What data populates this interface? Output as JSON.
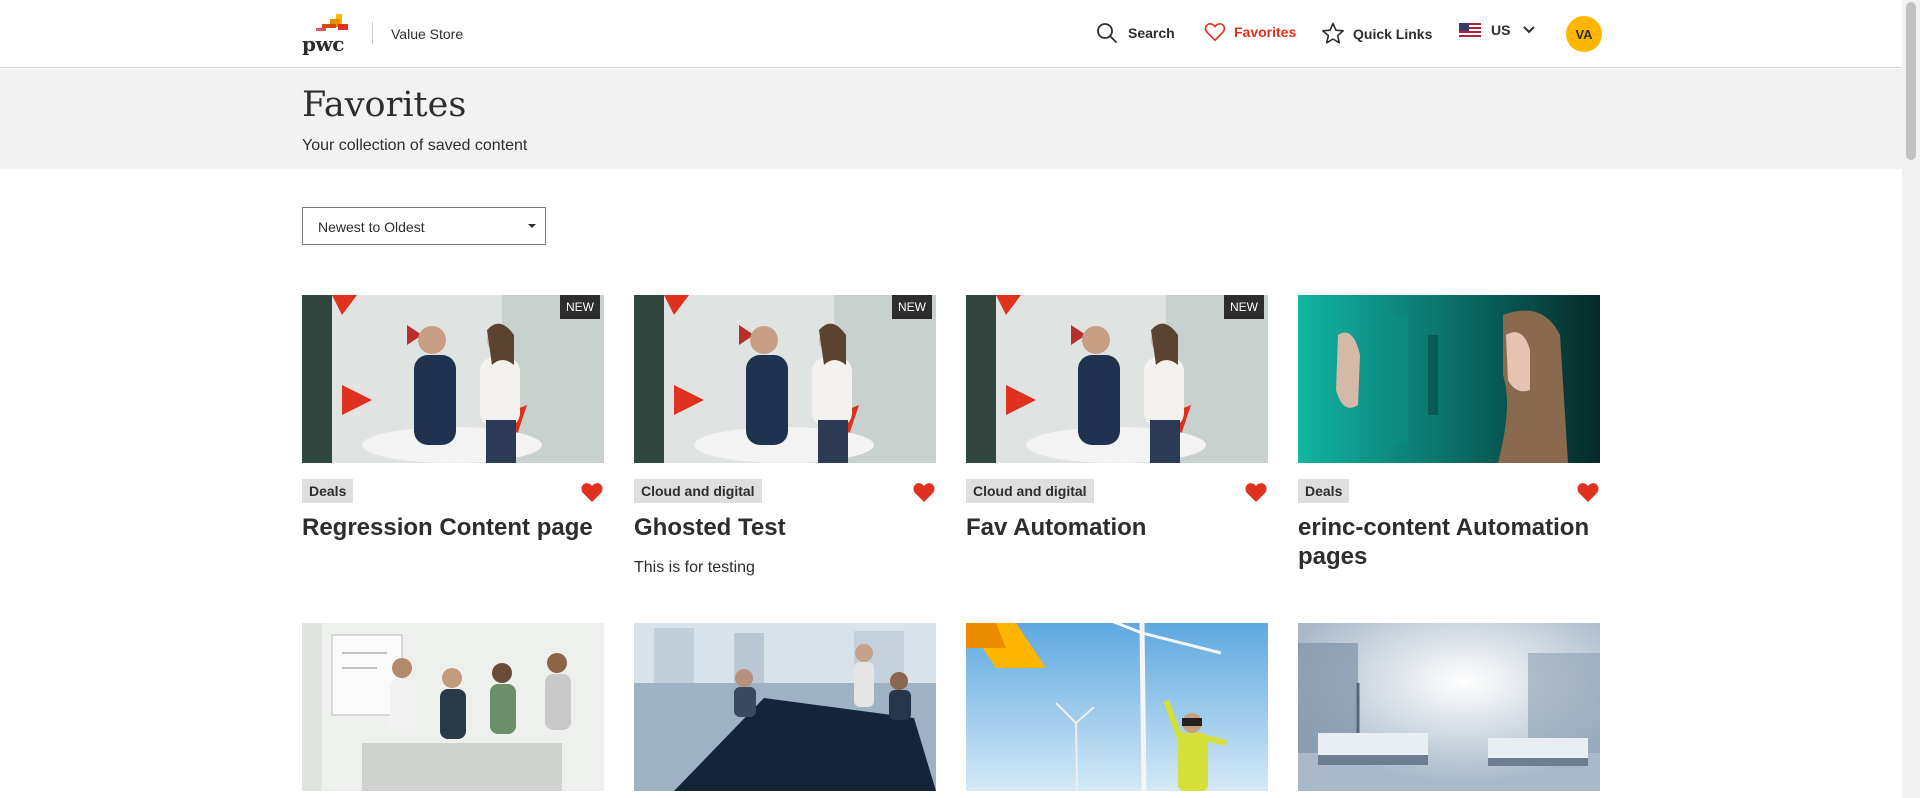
{
  "header": {
    "logo_text": "pwc",
    "store_name": "Value Store",
    "nav": {
      "search": "Search",
      "favorites": "Favorites",
      "quick_links": "Quick Links",
      "locale": "US"
    },
    "avatar_initials": "VA"
  },
  "hero": {
    "title": "Favorites",
    "subtitle": "Your collection of saved content"
  },
  "sort": {
    "selected": "Newest to Oldest"
  },
  "cards": [
    {
      "badge": "NEW",
      "tag": "Deals",
      "title": "Regression Content page",
      "description": "",
      "image": "handshake-office"
    },
    {
      "badge": "NEW",
      "tag": "Cloud and digital",
      "title": "Ghosted Test",
      "description": "This is for testing",
      "image": "handshake-office"
    },
    {
      "badge": "NEW",
      "tag": "Cloud and digital",
      "title": "Fav Automation",
      "description": "",
      "image": "handshake-office"
    },
    {
      "badge": "",
      "tag": "Deals",
      "title": "erinc-content Automation pages",
      "description": "",
      "image": "woman-teal-screen"
    },
    {
      "image": "team-meeting-whiteboard"
    },
    {
      "image": "boardroom-meeting"
    },
    {
      "image": "wind-turbines-vr"
    },
    {
      "image": "hospital-ward"
    }
  ],
  "colors": {
    "accent": "#e0301e",
    "avatar": "#ffb600",
    "hero_bg": "#f2f2f2",
    "badge_bg": "#2d2d2d",
    "tag_bg": "#dedede",
    "heart": "#e0301e"
  },
  "icons": {
    "search": "search-icon",
    "favorites": "heart-outline-icon",
    "quick_links": "star-icon",
    "locale": "us-flag-icon",
    "dropdown": "chevron-down-icon",
    "favorite_toggle": "heart-filled-icon"
  }
}
